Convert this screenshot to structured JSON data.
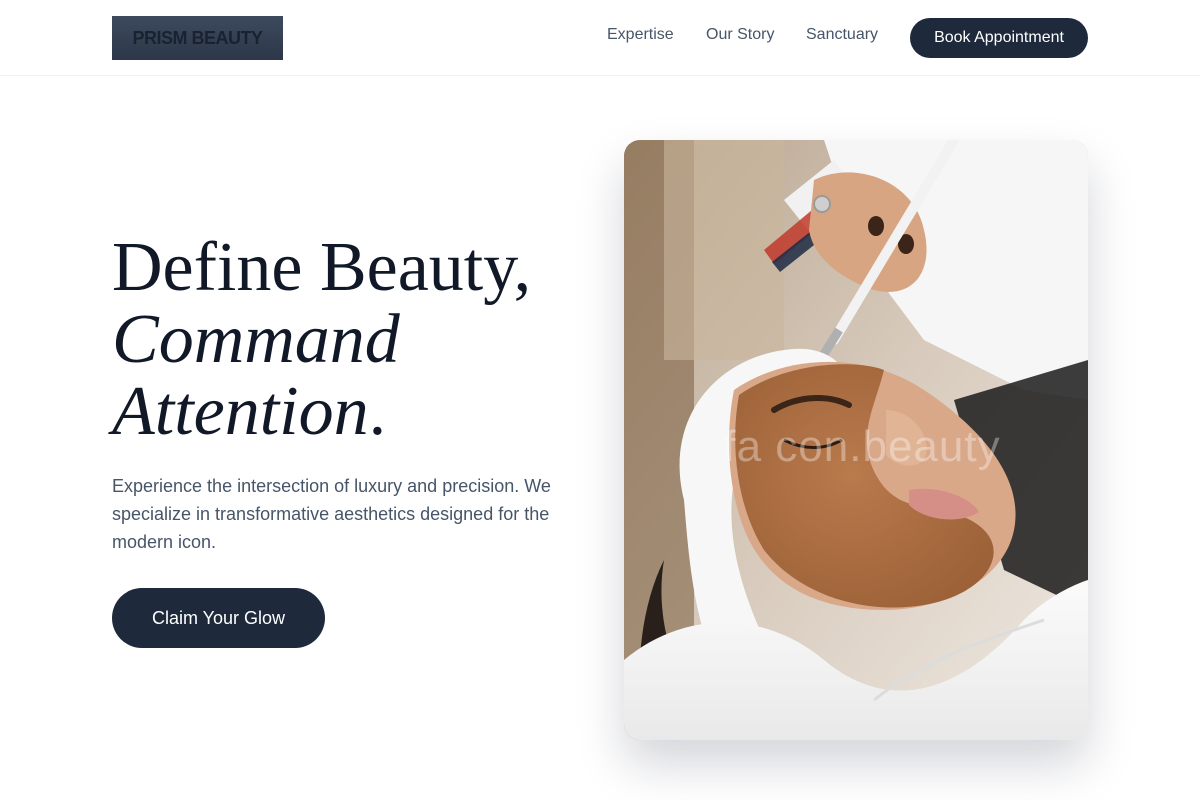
{
  "header": {
    "logo_text": "PRISM BEAUTY",
    "nav": [
      {
        "label": "Expertise"
      },
      {
        "label": "Our Story"
      },
      {
        "label": "Sanctuary"
      }
    ],
    "cta_label": "Book Appointment"
  },
  "hero": {
    "headline_line1": "Define Beauty,",
    "headline_line2": "Command",
    "headline_line3": "Attention",
    "headline_period": ".",
    "description": "Experience the intersection of luxury and precision. We specialize in transformative aesthetics designed for the modern icon.",
    "cta_label": "Claim Your Glow"
  },
  "image": {
    "subject": "facial-mask-treatment-photo",
    "watermark": "fa con.beauty"
  },
  "colors": {
    "primary": "#1e293b",
    "headline": "#111827",
    "body_text": "#475569",
    "background": "#ffffff"
  }
}
